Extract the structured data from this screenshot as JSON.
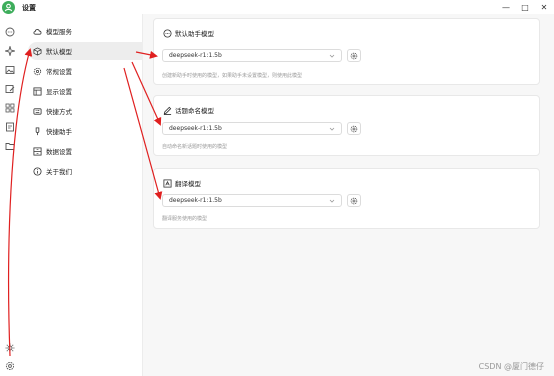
{
  "window": {
    "title": "设置",
    "minimize_glyph": "—",
    "maximize_glyph": "□",
    "close_glyph": "✕"
  },
  "rail": {
    "icons": [
      "chat-icon",
      "sparkle-icon",
      "image-icon",
      "image-edit-icon",
      "apps-icon",
      "document-edit-icon",
      "folder-icon",
      "brightness-icon",
      "settings-icon"
    ]
  },
  "sidebar": {
    "items": [
      {
        "label": "模型服务",
        "icon": "cloud-icon",
        "active": false
      },
      {
        "label": "默认模型",
        "icon": "cube-icon",
        "active": true
      },
      {
        "label": "常规设置",
        "icon": "gear-icon",
        "active": false
      },
      {
        "label": "显示设置",
        "icon": "monitor-icon",
        "active": false
      },
      {
        "label": "快捷方式",
        "icon": "rocket-icon",
        "active": false
      },
      {
        "label": "快捷助手",
        "icon": "bulb-icon",
        "active": false
      },
      {
        "label": "数据设置",
        "icon": "database-icon",
        "active": false
      },
      {
        "label": "关于我们",
        "icon": "info-icon",
        "active": false
      }
    ]
  },
  "cards": [
    {
      "title": "默认助手模型",
      "icon": "message-icon",
      "model": "deepseek-r1:1.5b",
      "desc": "创建新助手时使用的模型，如果助手未设置模型，则使用此模型"
    },
    {
      "title": "话题命名模型",
      "icon": "pen-icon",
      "model": "deepseek-r1:1.5b",
      "desc": "自动命名新话题时使用的模型"
    },
    {
      "title": "翻译模型",
      "icon": "translate-icon",
      "model": "deepseek-r1:1.5b",
      "desc": "翻译服务使用的模型"
    }
  ],
  "watermark": "CSDN @厦门德仔",
  "colors": {
    "accent_green": "#3dad5b",
    "arrow_red": "#e02020",
    "active_bg": "#ededed",
    "main_bg": "#f7f7f7"
  }
}
